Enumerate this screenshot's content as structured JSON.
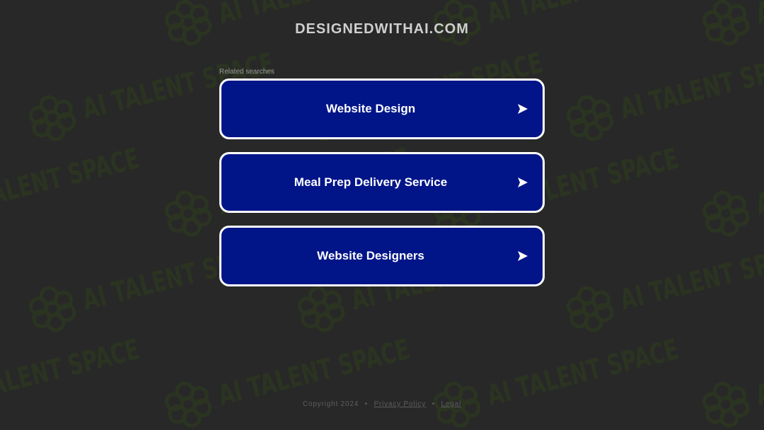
{
  "header": {
    "site_title": "DESIGNEDWITHAI.COM"
  },
  "watermark": {
    "text": "AI TALENT SPACE",
    "logo_icon": "brain-icon",
    "color": "#2f3e1c"
  },
  "related": {
    "label": "Related searches",
    "items": [
      {
        "label": "Website Design",
        "icon": "arrow-right-icon"
      },
      {
        "label": "Meal Prep Delivery Service",
        "icon": "arrow-right-icon"
      },
      {
        "label": "Website Designers",
        "icon": "arrow-right-icon"
      }
    ]
  },
  "footer": {
    "copyright": "Copyright 2024",
    "separator": "•",
    "privacy_label": "Privacy Policy",
    "legal_label": "Legal"
  },
  "colors": {
    "background": "#282828",
    "button_fill": "#021588",
    "button_border": "#ffffff",
    "title_text": "#cfcfcf"
  }
}
